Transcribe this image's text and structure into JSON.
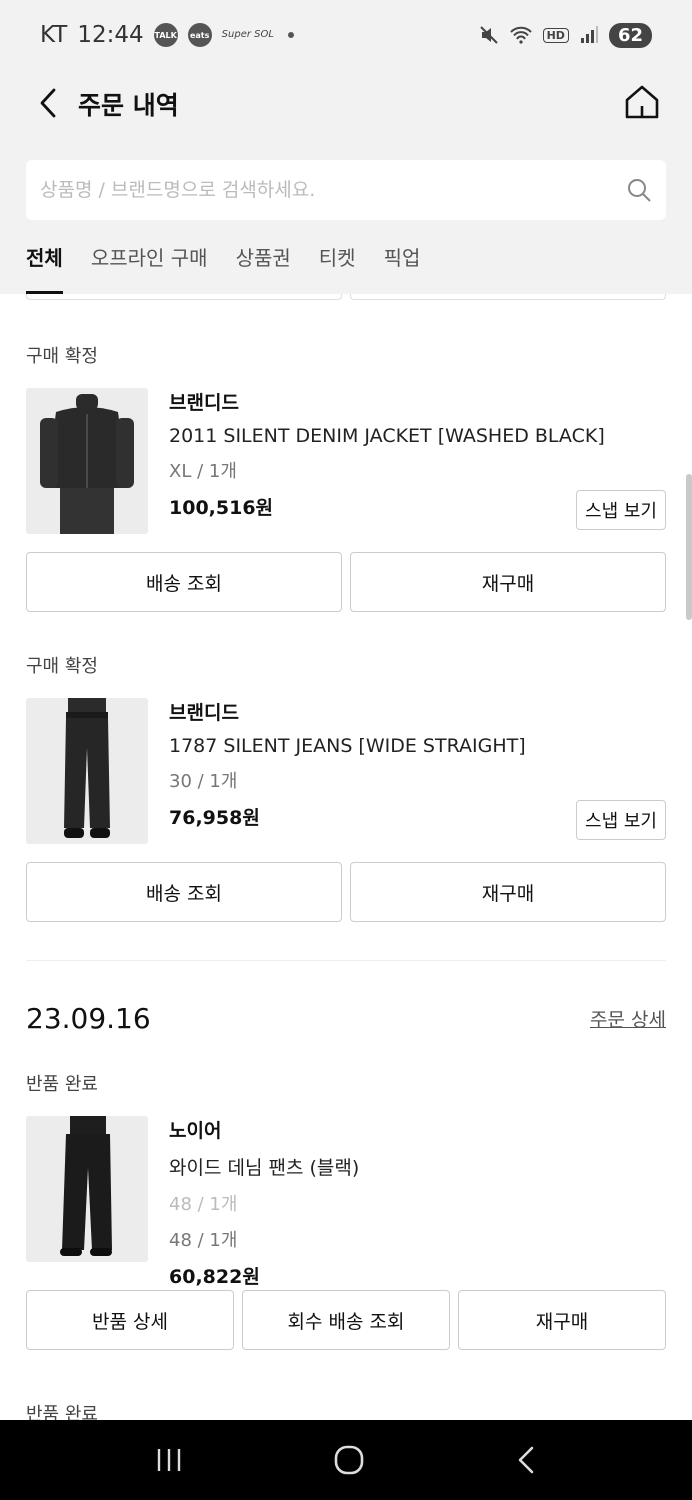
{
  "status_bar": {
    "carrier": "KT",
    "time": "12:44",
    "app_badge_1": "TALK",
    "app_badge_2": "eats",
    "app_text": "Super SOL",
    "battery": "62",
    "signal_label": "HD"
  },
  "header": {
    "title": "주문 내역",
    "search_placeholder": "상품명 / 브랜드명으로 검색하세요.",
    "tabs": [
      "전체",
      "오프라인 구매",
      "상품권",
      "티켓",
      "픽업"
    ]
  },
  "orders": [
    {
      "status": "구매 확정",
      "brand": "브랜디드",
      "product": "2011 SILENT DENIM JACKET [WASHED BLACK]",
      "option": "XL / 1개",
      "price": "100,516원",
      "snap_label": "스냅 보기",
      "buttons": [
        "배송 조회",
        "재구매"
      ]
    },
    {
      "status": "구매 확정",
      "brand": "브랜디드",
      "product": "1787 SILENT JEANS [WIDE STRAIGHT]",
      "option": "30 / 1개",
      "price": "76,958원",
      "snap_label": "스냅 보기",
      "buttons": [
        "배송 조회",
        "재구매"
      ]
    }
  ],
  "order_group": {
    "date": "23.09.16",
    "detail_link": "주문 상세",
    "item": {
      "status": "반품 완료",
      "brand": "노이어",
      "product": "와이드 데님 팬츠 (블랙)",
      "option_old": "48 / 1개",
      "option": "48 / 1개",
      "price": "60,822원",
      "buttons": [
        "반품 상세",
        "회수 배송 조회",
        "재구매"
      ]
    },
    "next_status": "반품 완료"
  }
}
